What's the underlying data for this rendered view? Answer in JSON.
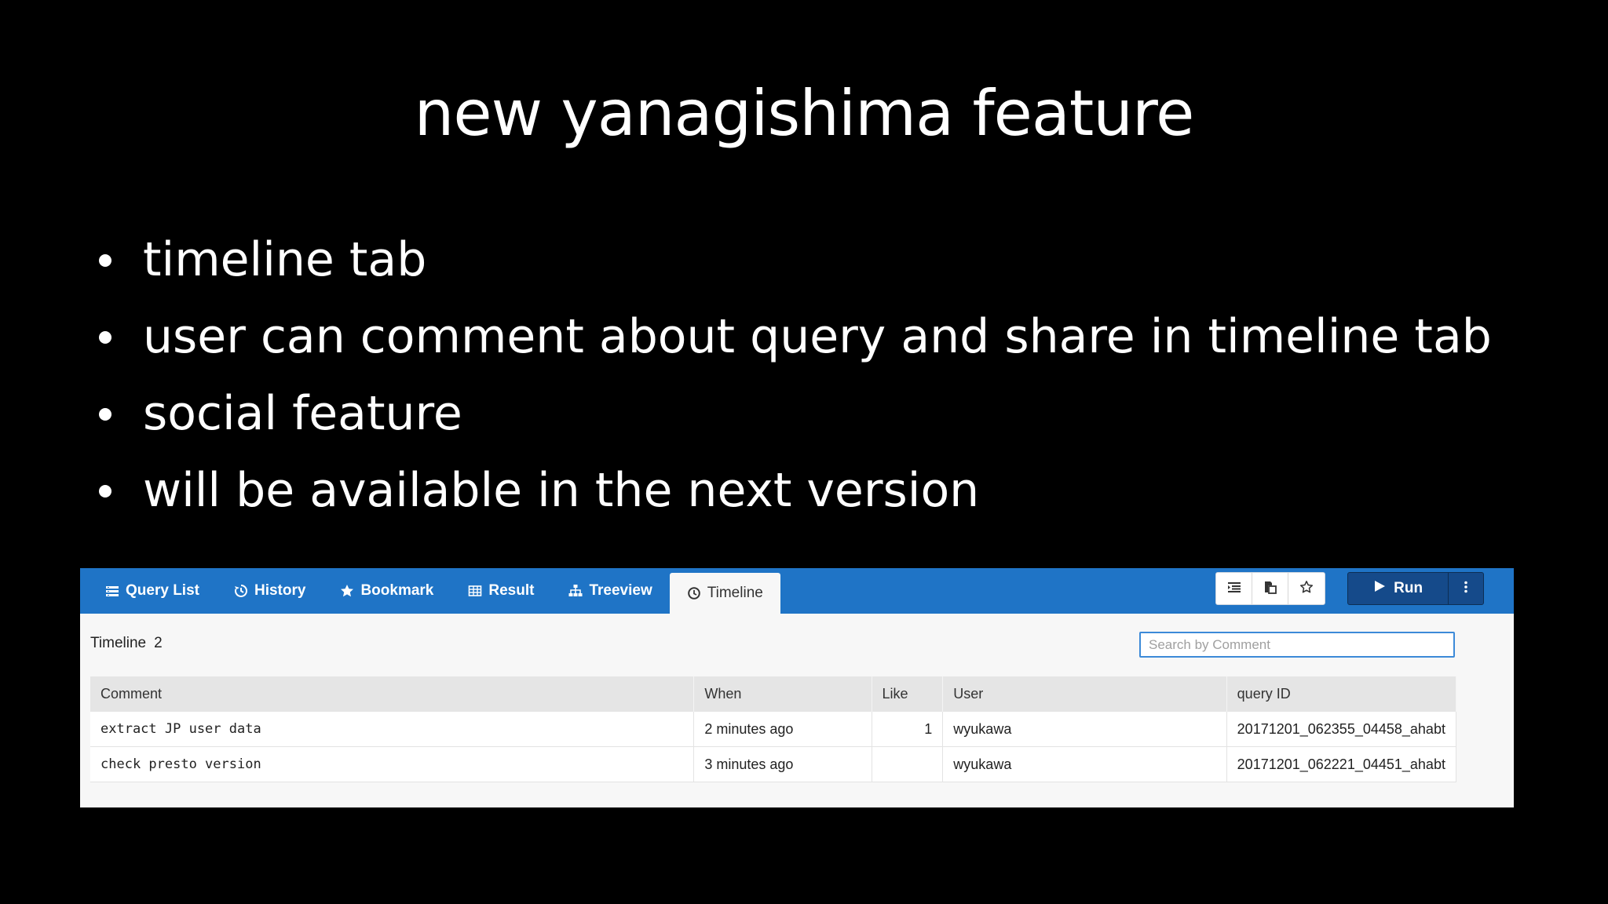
{
  "slide": {
    "title": "new yanagishima feature",
    "bullets": [
      "timeline tab",
      "user can comment about query and share in timeline tab",
      "social feature",
      "will be available in the next version"
    ]
  },
  "app": {
    "tabs": [
      {
        "label": "Query List",
        "icon": "list-icon"
      },
      {
        "label": "History",
        "icon": "history-icon"
      },
      {
        "label": "Bookmark",
        "icon": "star-icon"
      },
      {
        "label": "Result",
        "icon": "table-icon"
      },
      {
        "label": "Treeview",
        "icon": "sitemap-icon"
      },
      {
        "label": "Timeline",
        "icon": "clock-icon",
        "active": true
      }
    ],
    "toolbar": {
      "icons": [
        "format-icon",
        "copy-icon",
        "bookmark-star-icon"
      ],
      "run_label": "Run"
    },
    "timeline": {
      "label": "Timeline",
      "count": "2"
    },
    "search": {
      "placeholder": "Search by Comment"
    },
    "table": {
      "headers": [
        "Comment",
        "When",
        "Like",
        "User",
        "query ID"
      ],
      "rows": [
        {
          "comment": "extract JP user data",
          "when": "2 minutes ago",
          "like": "1",
          "user": "wyukawa",
          "query_id": "20171201_062355_04458_ahabt"
        },
        {
          "comment": "check presto version",
          "when": "3 minutes ago",
          "like": "",
          "user": "wyukawa",
          "query_id": "20171201_062221_04451_ahabt"
        }
      ]
    },
    "colors": {
      "topbar": "#1f74c6",
      "run_button": "#154a8a",
      "link": "#2060b0"
    }
  }
}
